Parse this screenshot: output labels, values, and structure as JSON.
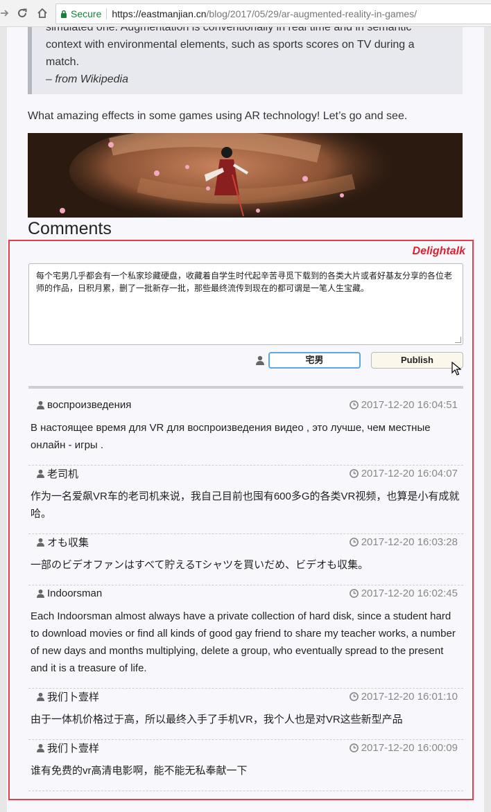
{
  "browser": {
    "secure_label": "Secure",
    "url_main": "https://eastmanjian.cn",
    "url_rest": "/blog/2017/05/29/ar-augmented-reality-in-games/"
  },
  "article": {
    "quote_lines": [
      "simulated one. Augmentation is conventionally in real time and in semantic",
      "context with environmental elements, such as sports scores on TV during a",
      "match."
    ],
    "quote_source": "– from Wikipedia",
    "intro": "What amazing effects in some games using AR technology! Let’s go and see.",
    "comments_heading": "Comments"
  },
  "delightalk": {
    "brand": "Delightalk",
    "textarea_value": "每个宅男几乎都会有一个私家珍藏硬盘，收藏着自学生时代起辛苦寻觅下载到的各类大片或者好基友分享的各位老师的作品，日积月累，删了一批新存一批，那些最终流传到现在的都可谓是一笔人生宝藏。",
    "nickname_value": "宅男",
    "publish_label": "Publish",
    "comments": [
      {
        "name": "воспроизведения",
        "time": "2017-12-20 16:04:51",
        "text": " В настоящее время  для  VR  для  воспроизведения  видео  ,  это  лучше,  чем  местные  онлайн - игры  ."
      },
      {
        "name": "老司机",
        "time": "2017-12-20 16:04:07",
        "text": "作为一名爱飙VR车的老司机来说，我自己目前也囤有600多G的各类VR视频，也算是小有成就哈。"
      },
      {
        "name": "オも収集",
        "time": "2017-12-20 16:03:28",
        "text": "一部のビデオファンはすべて貯えるTシャツを買いだめ、ビデオも収集。"
      },
      {
        "name": "Indoorsman",
        "time": "2017-12-20 16:02:45",
        "text": "Each Indoorsman almost always have a private collection of hard disk, since a student hard to download movies or find all kinds of good gay friend to share my teacher works, a number of new days and months multiplying, delete a group, who eventually spread to the present and it is a treasure of life."
      },
      {
        "name": "我们卜壹样",
        "time": "2017-12-20 16:01:10",
        "text": "由于一体机价格过于高，所以最终入手了手机VR，我个人也是对VR这些新型产品"
      },
      {
        "name": "我们卜壹样",
        "time": "2017-12-20 16:00:09",
        "text": "谁有免费的vr高清电影啊，能不能无私奉献一下"
      }
    ]
  }
}
